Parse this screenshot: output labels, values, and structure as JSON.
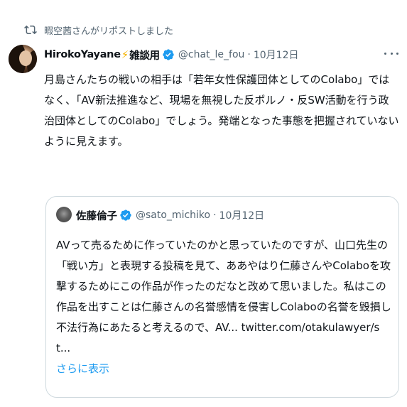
{
  "repost": {
    "icon": "repost-icon",
    "text": "暇空茜さんがリポストしました"
  },
  "tweet": {
    "author_name": "HirokoYayane",
    "name_emoji": "⚡",
    "name_suffix": "雑談用",
    "handle": "@chat_le_fou",
    "separator": "·",
    "date": "10月12日",
    "text": "月島さんたちの戦いの相手は「若年女性保護団体としてのColabo」ではなく、「AV新法推進など、現場を無視した反ポルノ・反SW活動を行う政治団体としてのColabo」でしょう。発端となった事態を把握されていないように見えます。"
  },
  "quote": {
    "author_name": "佐藤倫子",
    "handle": "@sato_michiko",
    "separator": "·",
    "date": "10月12日",
    "text": "AVって売るために作っていたのかと思っていたのですが、山口先生の「戦い方」と表現する投稿を見て、ああやはり仁藤さんやColaboを攻撃するためにこの作品が作ったのだなと改めて思いました。私はこの作品を出すことは仁藤さんの名誉感情を侵害しColaboの名誉を毀損し不法行為にあたると考えるので、AV... twitter.com/otakulawyer/st...",
    "show_more": "さらに表示"
  },
  "colors": {
    "accent": "#1d9bf0",
    "secondary_text": "#536471",
    "border": "#cfd9de"
  }
}
